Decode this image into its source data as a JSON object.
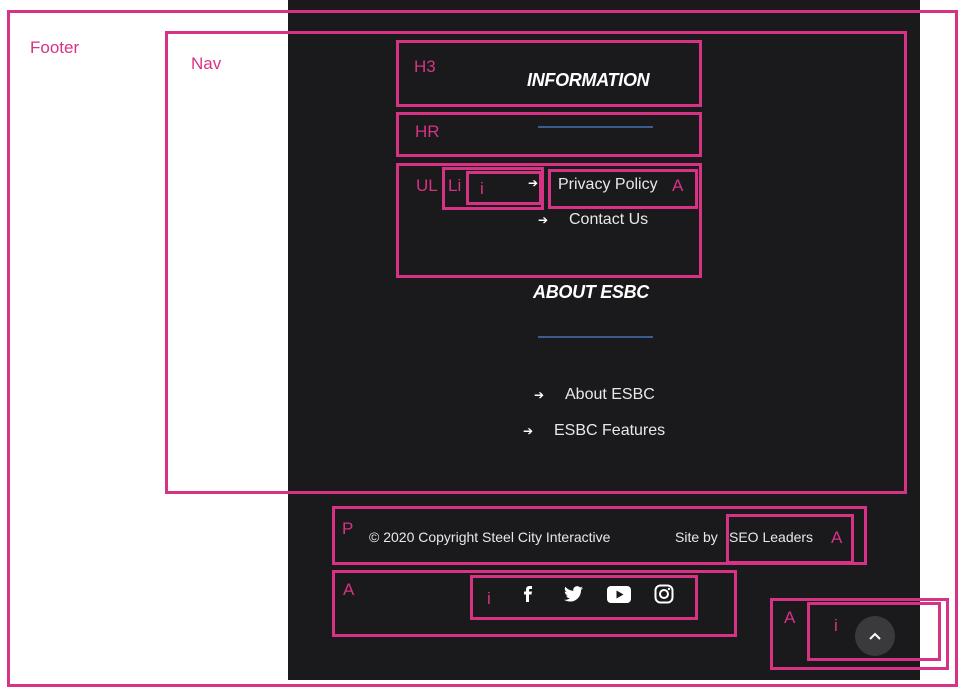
{
  "annotations": {
    "footer": "Footer",
    "nav": "Nav",
    "h3": "H3",
    "hr": "HR",
    "ul": "UL",
    "li": "Li",
    "i": "i",
    "a": "A",
    "p": "P"
  },
  "nav": {
    "information": {
      "title": "INFORMATION",
      "links": [
        "Privacy Policy",
        "Contact Us"
      ]
    },
    "about": {
      "title": "ABOUT ESBC",
      "links": [
        "About ESBC",
        "ESBC Features"
      ]
    }
  },
  "footer": {
    "copyright": "© 2020 Copyright Steel City Interactive",
    "site_by_prefix": "Site by",
    "site_by_link": "SEO Leaders"
  },
  "social": [
    "facebook-icon",
    "twitter-icon",
    "youtube-icon",
    "instagram-icon"
  ],
  "colors": {
    "annotation": "#d63384",
    "panel": "#1a1a1c",
    "rule": "#3a5d8f"
  }
}
